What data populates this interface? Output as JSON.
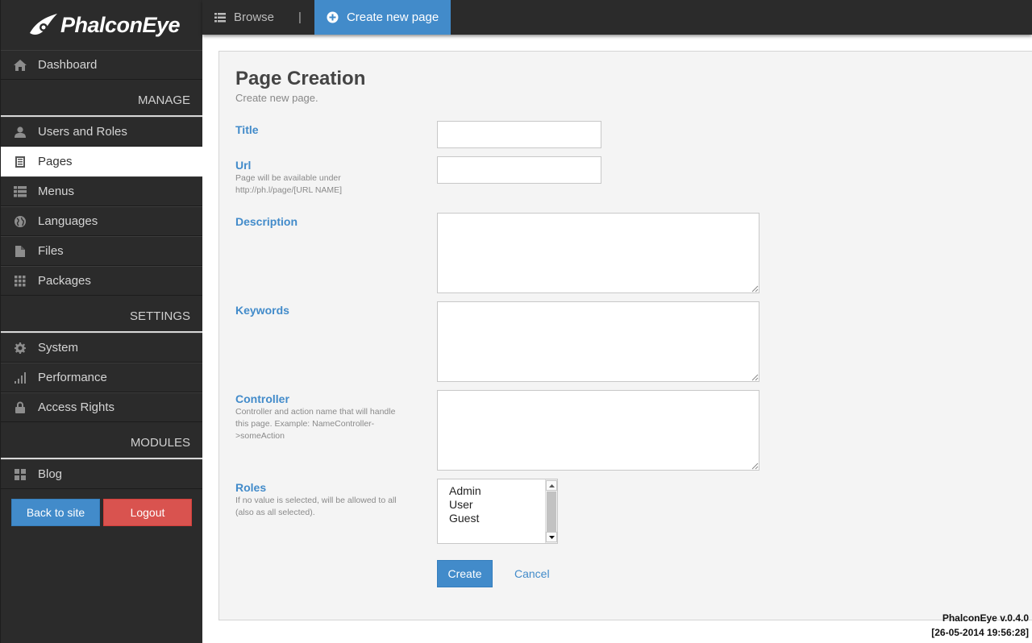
{
  "brand": {
    "name": "PhalconEye"
  },
  "sidebar": {
    "dashboard": "Dashboard",
    "sections": {
      "manage": "MANAGE",
      "settings": "SETTINGS",
      "modules": "MODULES"
    },
    "manage_items": [
      {
        "label": "Users and Roles",
        "icon": "user-icon"
      },
      {
        "label": "Pages",
        "icon": "pages-icon",
        "active": true
      },
      {
        "label": "Menus",
        "icon": "list-icon"
      },
      {
        "label": "Languages",
        "icon": "globe-icon"
      },
      {
        "label": "Files",
        "icon": "file-icon"
      },
      {
        "label": "Packages",
        "icon": "grid-icon"
      }
    ],
    "settings_items": [
      {
        "label": "System",
        "icon": "gear-icon"
      },
      {
        "label": "Performance",
        "icon": "signal-icon"
      },
      {
        "label": "Access Rights",
        "icon": "lock-icon"
      }
    ],
    "modules_items": [
      {
        "label": "Blog",
        "icon": "blog-icon"
      }
    ],
    "back_to_site": "Back to site",
    "logout": "Logout"
  },
  "topbar": {
    "browse": "Browse",
    "separator": "|",
    "create_new_page": "Create new page"
  },
  "form": {
    "title": "Page Creation",
    "subtitle": "Create new page.",
    "fields": {
      "title": {
        "label": "Title",
        "value": ""
      },
      "url": {
        "label": "Url",
        "help_line1": "Page will be available under",
        "help_line2": "http://ph.l/page/[URL NAME]",
        "value": ""
      },
      "description": {
        "label": "Description",
        "value": ""
      },
      "keywords": {
        "label": "Keywords",
        "value": ""
      },
      "controller": {
        "label": "Controller",
        "help": "Controller and action name that will handle this page. Example: NameController->someAction",
        "value": ""
      },
      "roles": {
        "label": "Roles",
        "help": "If no value is selected, will be allowed to all (also as all selected).",
        "options": [
          "Admin",
          "User",
          "Guest"
        ]
      }
    },
    "create": "Create",
    "cancel": "Cancel"
  },
  "footer": {
    "version": "PhalconEye v.0.4.0",
    "timestamp": "[26-05-2014 19:56:28]"
  },
  "colors": {
    "accent": "#428bca",
    "danger": "#d9534f",
    "sidebar_bg": "#2b2b2b"
  }
}
